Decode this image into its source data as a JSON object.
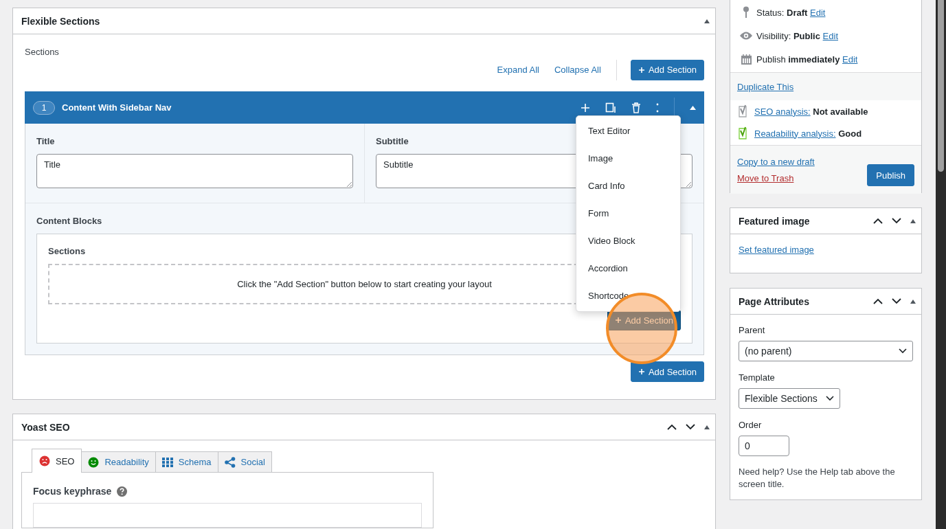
{
  "flexible_sections": {
    "title": "Flexible Sections",
    "sections_label": "Sections",
    "expand_all": "Expand All",
    "collapse_all": "Collapse All",
    "add_section": "Add Section",
    "layout": {
      "number": "1",
      "title": "Content With Sidebar Nav",
      "expanded": true,
      "fields": [
        {
          "label": "Title",
          "value": "Title"
        },
        {
          "label": "Subtitle",
          "value": "Subtitle"
        }
      ],
      "content_blocks": {
        "label": "Content Blocks",
        "sections_label": "Sections",
        "empty_message": "Click the \"Add Section\" button below to start creating your layout",
        "add_section": "Add Section"
      }
    },
    "add_section_bottom": "Add Section",
    "menu": {
      "items": [
        "Text Editor",
        "Image",
        "Card Info",
        "Form",
        "Video Block",
        "Accordion",
        "Shortcode"
      ]
    }
  },
  "yoast": {
    "title": "Yoast SEO",
    "tabs": [
      {
        "label": "SEO",
        "kind": "seo",
        "selected": true
      },
      {
        "label": "Readability",
        "kind": "readability",
        "selected": false
      },
      {
        "label": "Schema",
        "kind": "schema",
        "selected": false
      },
      {
        "label": "Social",
        "kind": "social",
        "selected": false
      }
    ],
    "focus_keyphrase_label": "Focus keyphrase"
  },
  "publish": {
    "rows": [
      {
        "kind": "status",
        "label": "Status:",
        "value": "Draft",
        "link": "Edit"
      },
      {
        "kind": "visibility",
        "label": "Visibility:",
        "value": "Public",
        "link": "Edit"
      },
      {
        "kind": "schedule",
        "label": "Publish",
        "value": "immediately",
        "link": "Edit"
      }
    ],
    "duplicate": "Duplicate This",
    "analyses": [
      {
        "kind": "seo",
        "link": "SEO analysis:",
        "value": "Not available"
      },
      {
        "kind": "readability",
        "link": "Readability analysis:",
        "value": "Good"
      }
    ],
    "copy_draft": "Copy to a new draft",
    "trash": "Move to Trash",
    "publish_button": "Publish"
  },
  "featured_image": {
    "title": "Featured image",
    "link": "Set featured image"
  },
  "page_attributes": {
    "title": "Page Attributes",
    "parent_label": "Parent",
    "parent_value": "(no parent)",
    "template_label": "Template",
    "template_value": "Flexible Sections",
    "order_label": "Order",
    "order_value": "0",
    "help": "Need help? Use the Help tab above the screen title."
  }
}
